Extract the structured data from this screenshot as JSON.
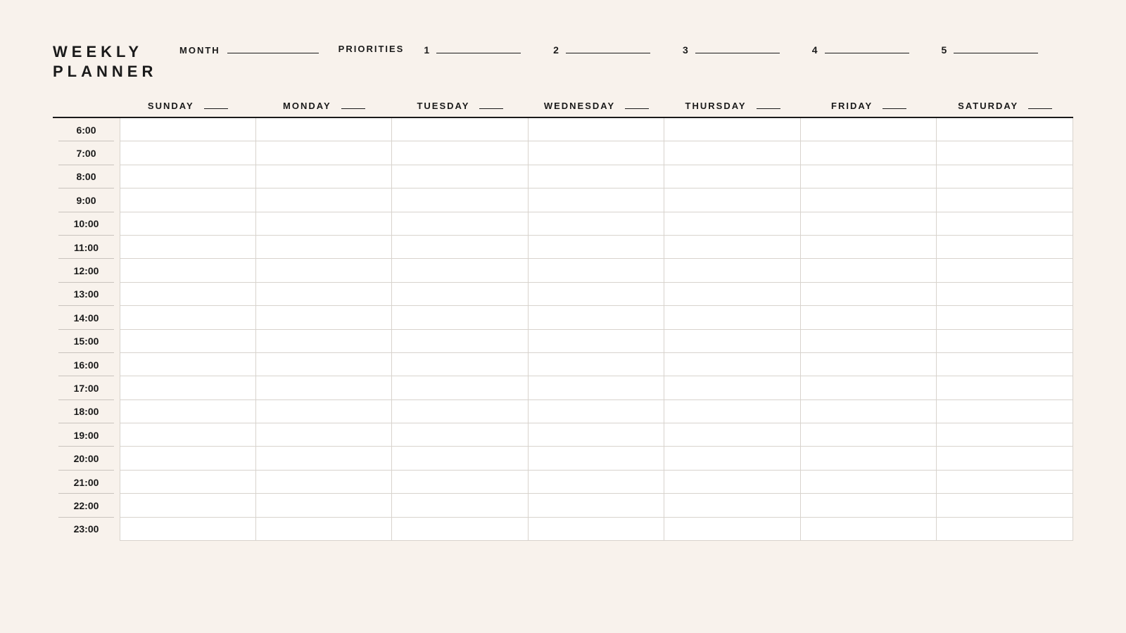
{
  "title_line1": "WEEKLY",
  "title_line2": "PLANNER",
  "month_label": "MONTH",
  "priorities_label": "PRIORITIES",
  "priorities": [
    "1",
    "2",
    "3",
    "4",
    "5"
  ],
  "days": [
    "SUNDAY",
    "MONDAY",
    "TUESDAY",
    "WEDNESDAY",
    "THURSDAY",
    "FRIDAY",
    "SATURDAY"
  ],
  "times": [
    "6:00",
    "7:00",
    "8:00",
    "9:00",
    "10:00",
    "11:00",
    "12:00",
    "13:00",
    "14:00",
    "15:00",
    "16:00",
    "17:00",
    "18:00",
    "19:00",
    "20:00",
    "21:00",
    "22:00",
    "23:00"
  ]
}
